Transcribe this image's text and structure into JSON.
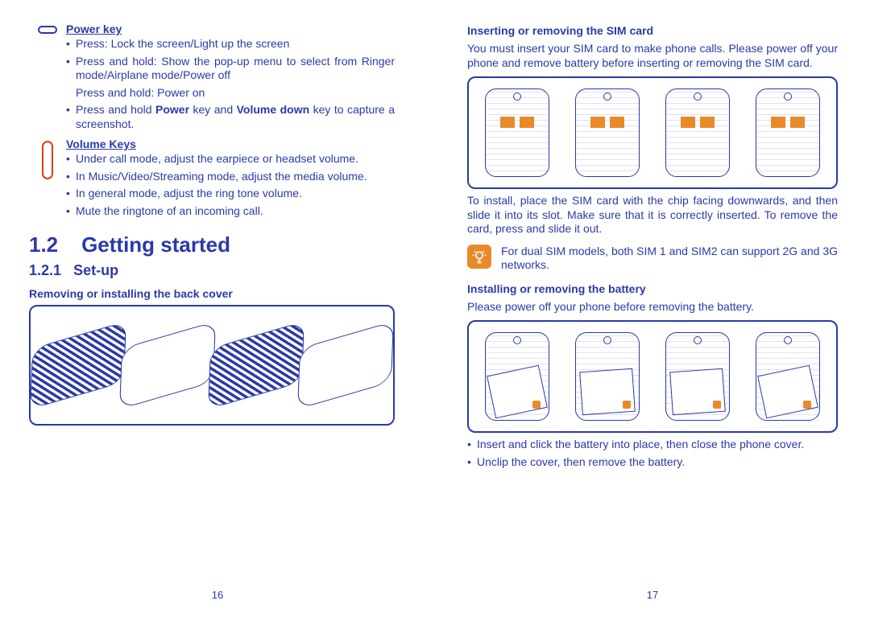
{
  "left": {
    "power": {
      "heading": "Power key",
      "items": [
        "Press: Lock the screen/Light up the screen",
        "Press and hold: Show the pop-up menu to select from Ringer mode/Airplane mode/Power off",
        "Press and hold Power key and Volume down key to capture a screenshot."
      ],
      "cont_after_1": "Press and hold: Power on"
    },
    "volume": {
      "heading": "Volume Keys",
      "items": [
        "Under call mode, adjust the earpiece or headset volume.",
        "In Music/Video/Streaming mode, adjust the media volume.",
        "In general mode, adjust the ring tone volume.",
        "Mute the ringtone of an incoming call."
      ]
    },
    "section_num": "1.2",
    "section_title": "Getting started",
    "sub_num": "1.2.1",
    "sub_title": "Set-up",
    "figcap1": "Removing or installing the back cover",
    "pagenum": "16"
  },
  "right": {
    "sim_heading": "Inserting or removing the SIM card",
    "sim_para": "You must insert your SIM card to make phone calls. Please power off your phone and remove battery before inserting or removing the SIM card.",
    "sim_after": "To install, place the SIM card with the chip facing downwards, and then slide it into its slot. Make sure that it is correctly inserted. To remove the card, press and slide it out.",
    "tip": "For dual SIM models, both SIM 1 and SIM2 can support 2G and 3G networks.",
    "batt_heading": "Installing or removing the battery",
    "batt_para": "Please power off your phone before removing the battery.",
    "batt_items": [
      "Insert and click the battery into place, then close the phone cover.",
      "Unclip the cover, then remove the battery."
    ],
    "pagenum": "17"
  }
}
